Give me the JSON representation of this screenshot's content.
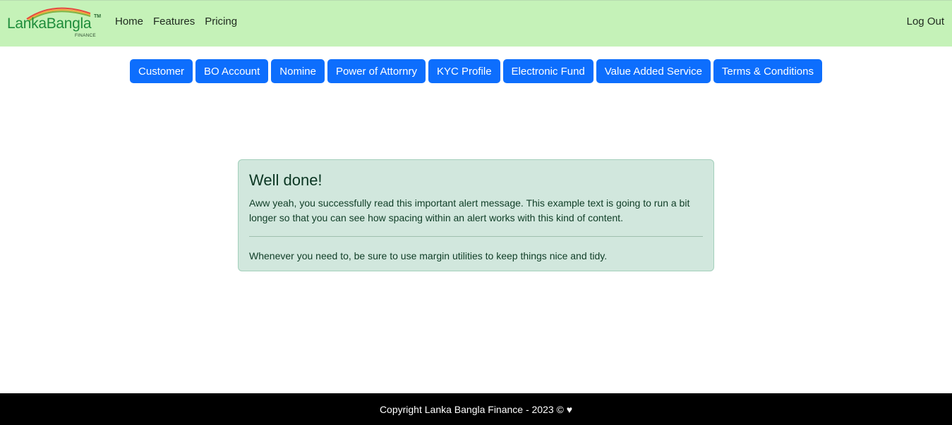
{
  "brand": {
    "name": "LankaBangla",
    "trademark": "TM",
    "subtitle": "FINANCE"
  },
  "nav": {
    "links": [
      "Home",
      "Features",
      "Pricing"
    ],
    "logout": "Log Out"
  },
  "buttons": [
    "Customer",
    "BO Account",
    "Nomine",
    "Power of Attornry",
    "KYC Profile",
    "Electronic Fund",
    "Value Added Service",
    "Terms & Conditions"
  ],
  "alert": {
    "heading": "Well done!",
    "body": "Aww yeah, you successfully read this important alert message. This example text is going to run a bit longer so that you can see how spacing within an alert works with this kind of content.",
    "footer": "Whenever you need to, be sure to use margin utilities to keep things nice and tidy."
  },
  "footer": {
    "text": "Copyright Lanka Bangla Finance - 2023 © ♥"
  },
  "colors": {
    "navbar_bg": "#c5f2b8",
    "button_bg": "#0d6efd",
    "alert_bg": "#d1e7dd",
    "footer_bg": "#000000"
  }
}
